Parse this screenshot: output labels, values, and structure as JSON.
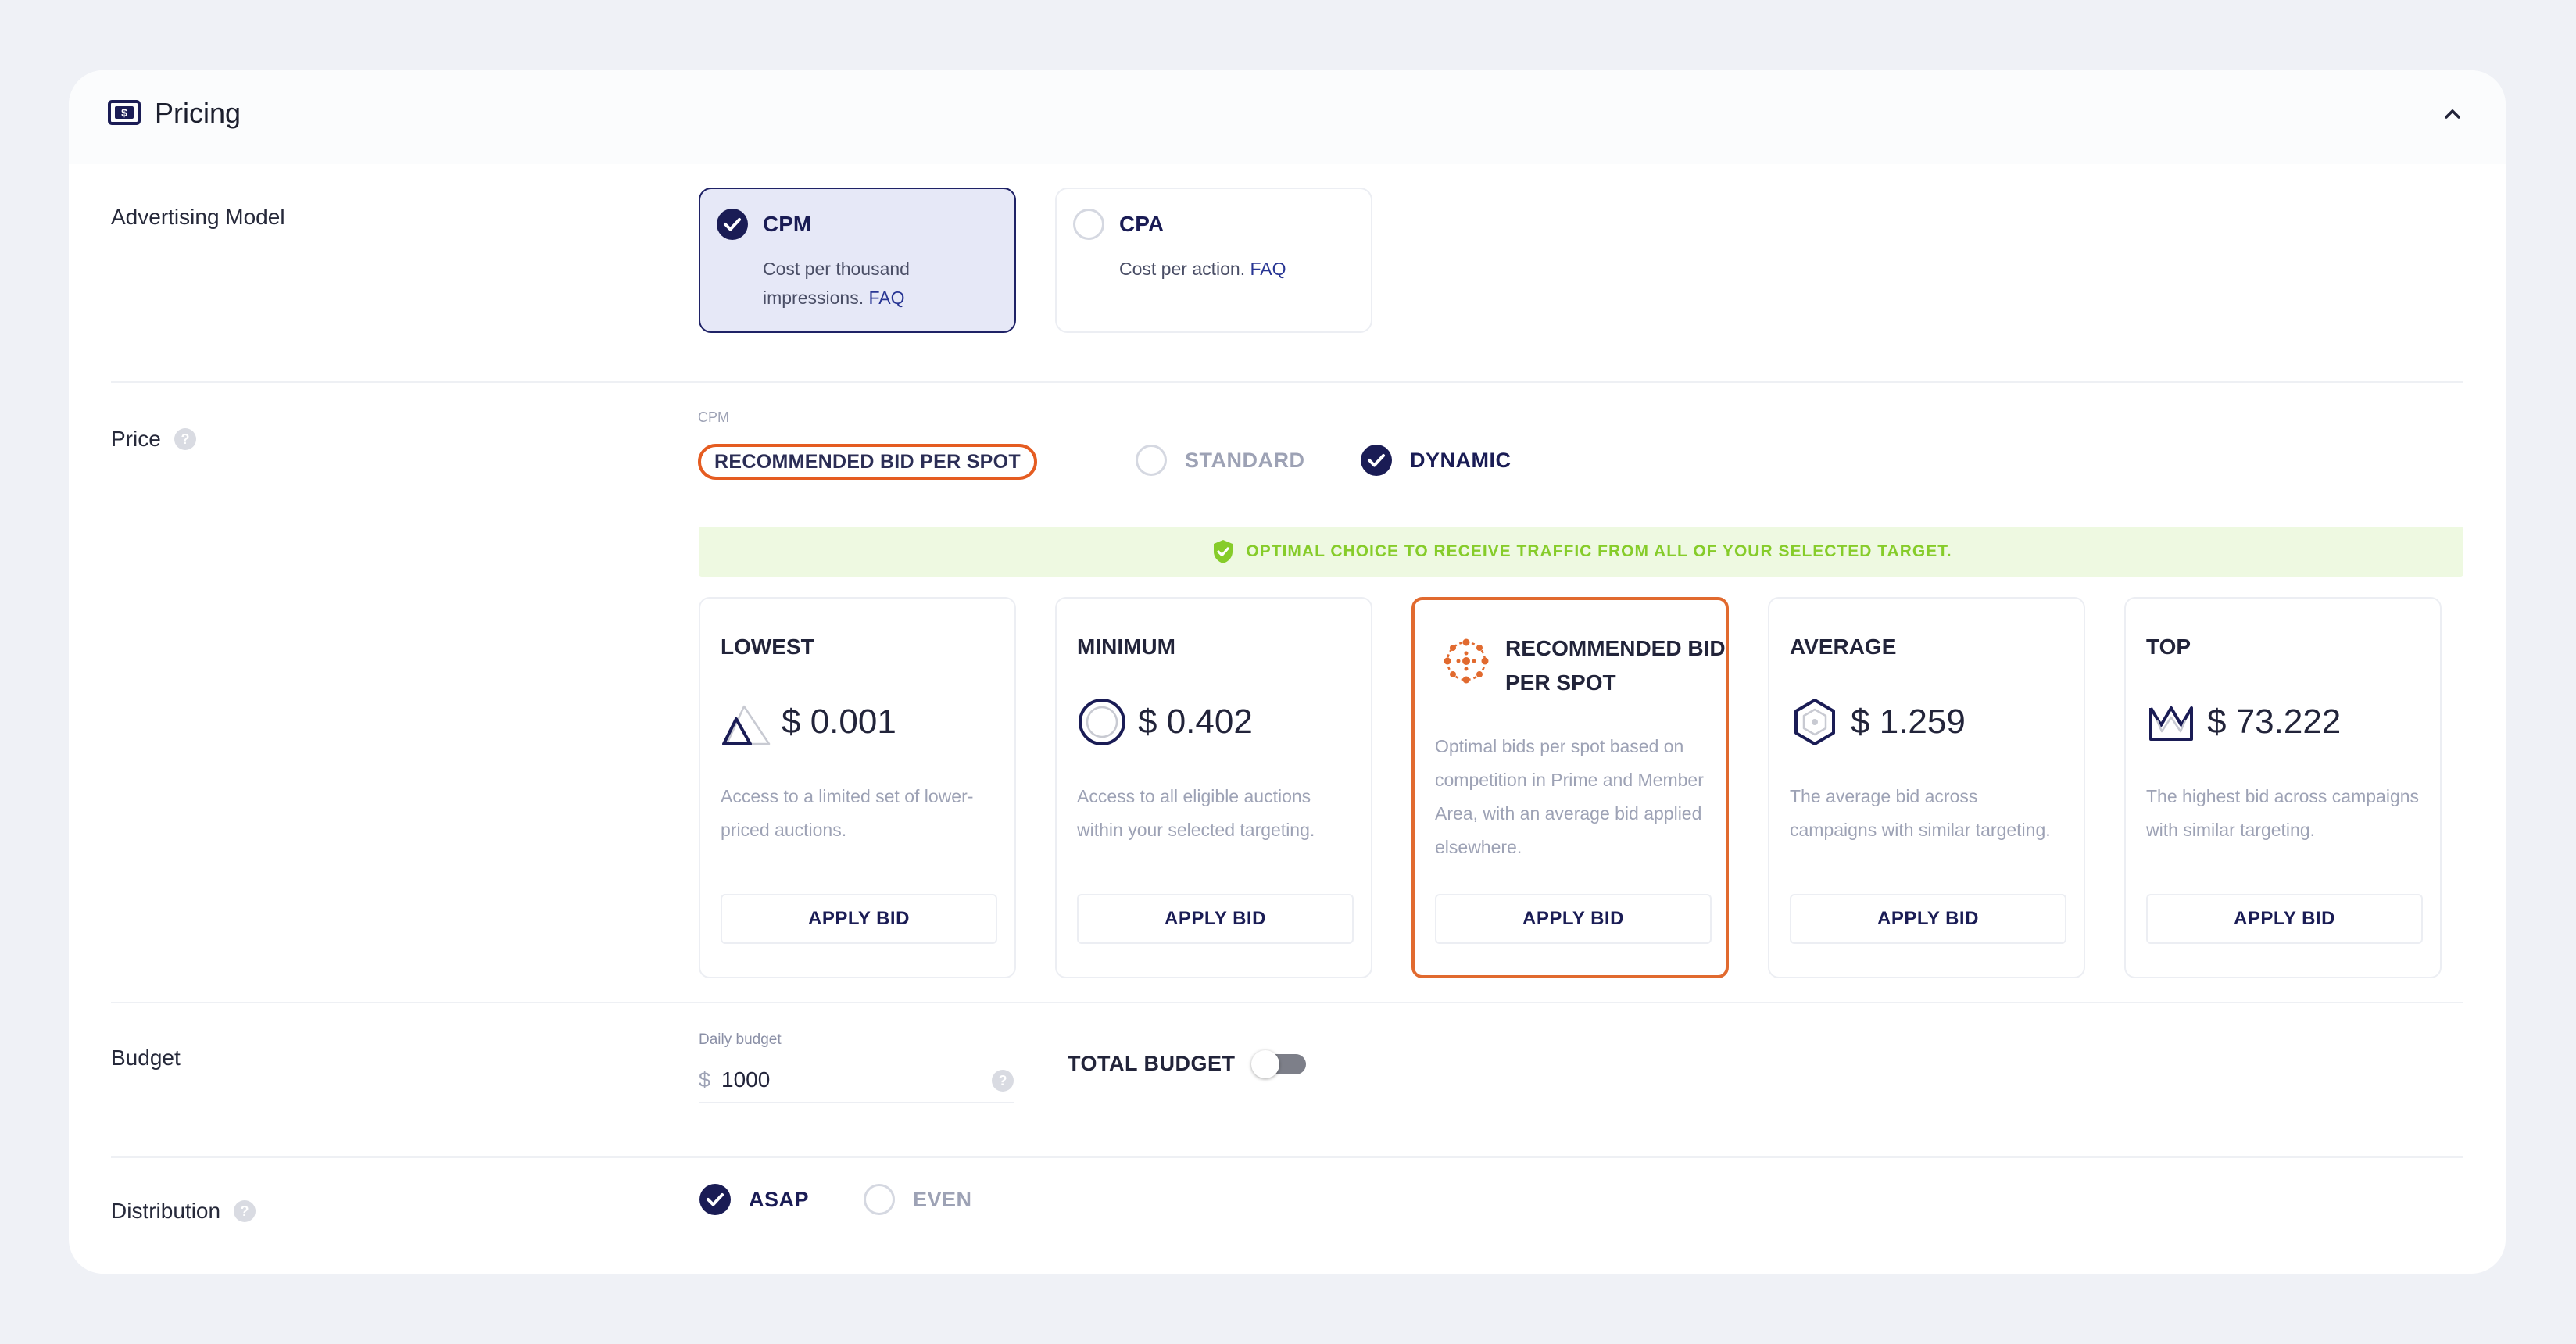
{
  "header": {
    "title": "Pricing"
  },
  "advertising_model": {
    "label": "Advertising Model",
    "options": [
      {
        "title": "CPM",
        "desc": "Cost per thousand impressions.",
        "faq": "FAQ",
        "selected": true
      },
      {
        "title": "CPA",
        "desc": "Cost per action.",
        "faq": "FAQ",
        "selected": false
      }
    ]
  },
  "price": {
    "label": "Price",
    "tag": "CPM",
    "recommended_pill": "RECOMMENDED BID PER SPOT",
    "modes": [
      {
        "label": "STANDARD",
        "selected": false
      },
      {
        "label": "DYNAMIC",
        "selected": true
      }
    ],
    "banner": "OPTIMAL CHOICE TO RECEIVE TRAFFIC FROM ALL OF YOUR SELECTED TARGET.",
    "bids": [
      {
        "title": "LOWEST",
        "price": "$ 0.001",
        "desc": "Access to a limited set of lower-priced auctions.",
        "button": "APPLY BID",
        "icon": "triangle-icon"
      },
      {
        "title": "MINIMUM",
        "price": "$ 0.402",
        "desc": "Access to all eligible auctions within your selected targeting.",
        "button": "APPLY BID",
        "icon": "circle-icon"
      },
      {
        "title": "RECOMMENDED BID PER SPOT",
        "price": "",
        "desc": "Optimal bids per spot based on competition in Prime and Member Area, with an average bid applied elsewhere.",
        "button": "APPLY BID",
        "icon": "network-icon"
      },
      {
        "title": "AVERAGE",
        "price": "$ 1.259",
        "desc": "The average bid across campaigns with similar targeting.",
        "button": "APPLY BID",
        "icon": "hexagon-icon"
      },
      {
        "title": "TOP",
        "price": "$ 73.222",
        "desc": "The highest bid across campaigns with similar targeting.",
        "button": "APPLY BID",
        "icon": "crown-icon"
      }
    ]
  },
  "budget": {
    "label": "Budget",
    "daily_label": "Daily budget",
    "currency": "$",
    "daily_value": "1000",
    "total_label": "TOTAL BUDGET"
  },
  "distribution": {
    "label": "Distribution",
    "options": [
      {
        "label": "ASAP",
        "selected": true
      },
      {
        "label": "EVEN",
        "selected": false
      }
    ]
  },
  "colors": {
    "accent": "#1a1c55",
    "recommended": "#e16a2f",
    "success": "#86cc2a"
  }
}
